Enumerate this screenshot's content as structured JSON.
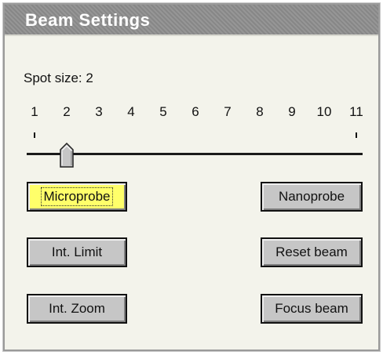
{
  "panel": {
    "title": "Beam Settings"
  },
  "spot": {
    "label": "Spot size: 2",
    "value": 2,
    "min": 1,
    "max": 11,
    "ticks": [
      "1",
      "2",
      "3",
      "4",
      "5",
      "6",
      "7",
      "8",
      "9",
      "10",
      "11"
    ]
  },
  "buttons": {
    "microprobe": "Microprobe",
    "nanoprobe": "Nanoprobe",
    "int_limit": "Int. Limit",
    "reset_beam": "Reset beam",
    "int_zoom": "Int. Zoom",
    "focus_beam": "Focus beam"
  },
  "state": {
    "active_probe": "microprobe"
  },
  "colors": {
    "active_button": "#ffff6a",
    "button_face": "#c6c6c6",
    "panel_bg": "#f3f3eb",
    "title_bar": "#8f8f8f"
  }
}
